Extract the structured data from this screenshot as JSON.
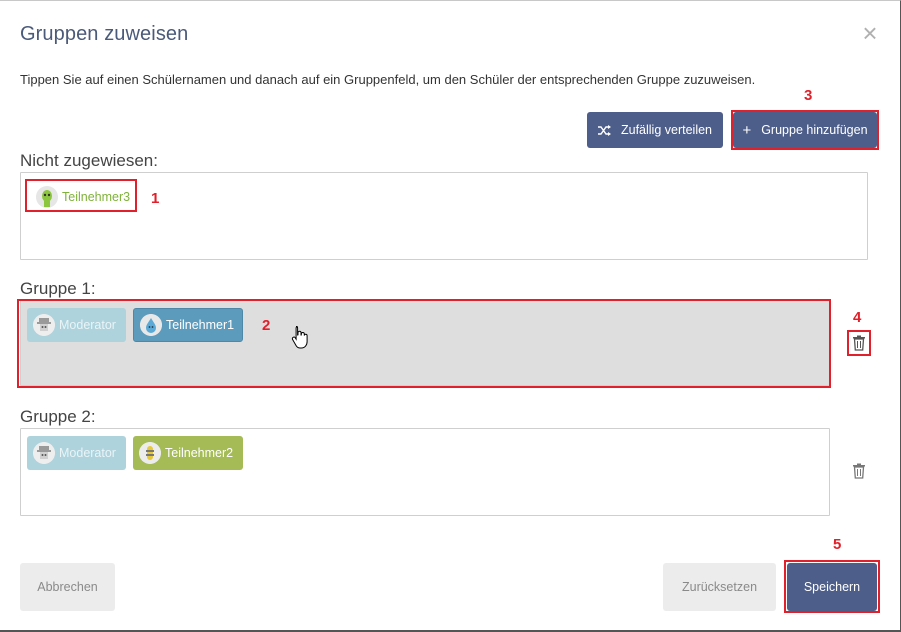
{
  "dialog": {
    "title": "Gruppen zuweisen",
    "close_label": "×",
    "hint": "Tippen Sie auf einen Schülernamen und danach auf ein Gruppenfeld, um den Schüler der entsprechenden Gruppe zuzuweisen."
  },
  "actions": {
    "random_label": "Zufällig verteilen",
    "add_group_label": "Gruppe hinzufügen",
    "add_group_plus": "+"
  },
  "unassigned": {
    "label": "Nicht zugewiesen:",
    "chips": [
      {
        "name": "Teilnehmer3",
        "avatar": "green-alien-avatar"
      }
    ]
  },
  "groups": [
    {
      "label": "Gruppe 1:",
      "chips": [
        {
          "name": "Moderator",
          "avatar": "hat-robot-avatar"
        },
        {
          "name": "Teilnehmer1",
          "avatar": "blue-drop-avatar"
        }
      ]
    },
    {
      "label": "Gruppe 2:",
      "chips": [
        {
          "name": "Moderator",
          "avatar": "hat-robot-avatar"
        },
        {
          "name": "Teilnehmer2",
          "avatar": "yellow-robot-avatar"
        }
      ]
    }
  ],
  "footer": {
    "cancel_label": "Abbrechen",
    "reset_label": "Zurücksetzen",
    "save_label": "Speichern"
  },
  "annotations": [
    "1",
    "2",
    "3",
    "4",
    "5"
  ],
  "colors": {
    "primary": "#4e5e8a",
    "highlight": "#e0202a",
    "teal_chip": "#5d9bbd",
    "green_chip": "#a4bb56",
    "moderator_chip": "#aed3dc"
  }
}
